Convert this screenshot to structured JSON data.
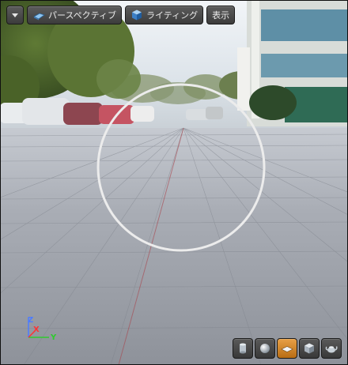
{
  "toolbar": {
    "menu_icon": "chevron-down-icon",
    "perspective_label": "パースペクティブ",
    "perspective_icon": "perspective-icon",
    "lighting_label": "ライティング",
    "lighting_icon": "lighting-cube-icon",
    "show_label": "表示"
  },
  "axis_gizmo": {
    "z": "Z",
    "x": "X",
    "y": "Y"
  },
  "colors": {
    "accent_active": "#d98a2a",
    "axis_x": "#ff3333",
    "axis_y": "#2fcc2f",
    "axis_z": "#4d7cff",
    "floor": "#9ea2aa",
    "sky": "#dfe6ec"
  },
  "view_modes": {
    "items": [
      {
        "icon": "cylinder-icon",
        "active": false
      },
      {
        "icon": "sphere-icon",
        "active": false
      },
      {
        "icon": "plane-icon",
        "active": true
      },
      {
        "icon": "cube-icon",
        "active": false
      },
      {
        "icon": "teapot-icon",
        "active": false
      }
    ]
  }
}
